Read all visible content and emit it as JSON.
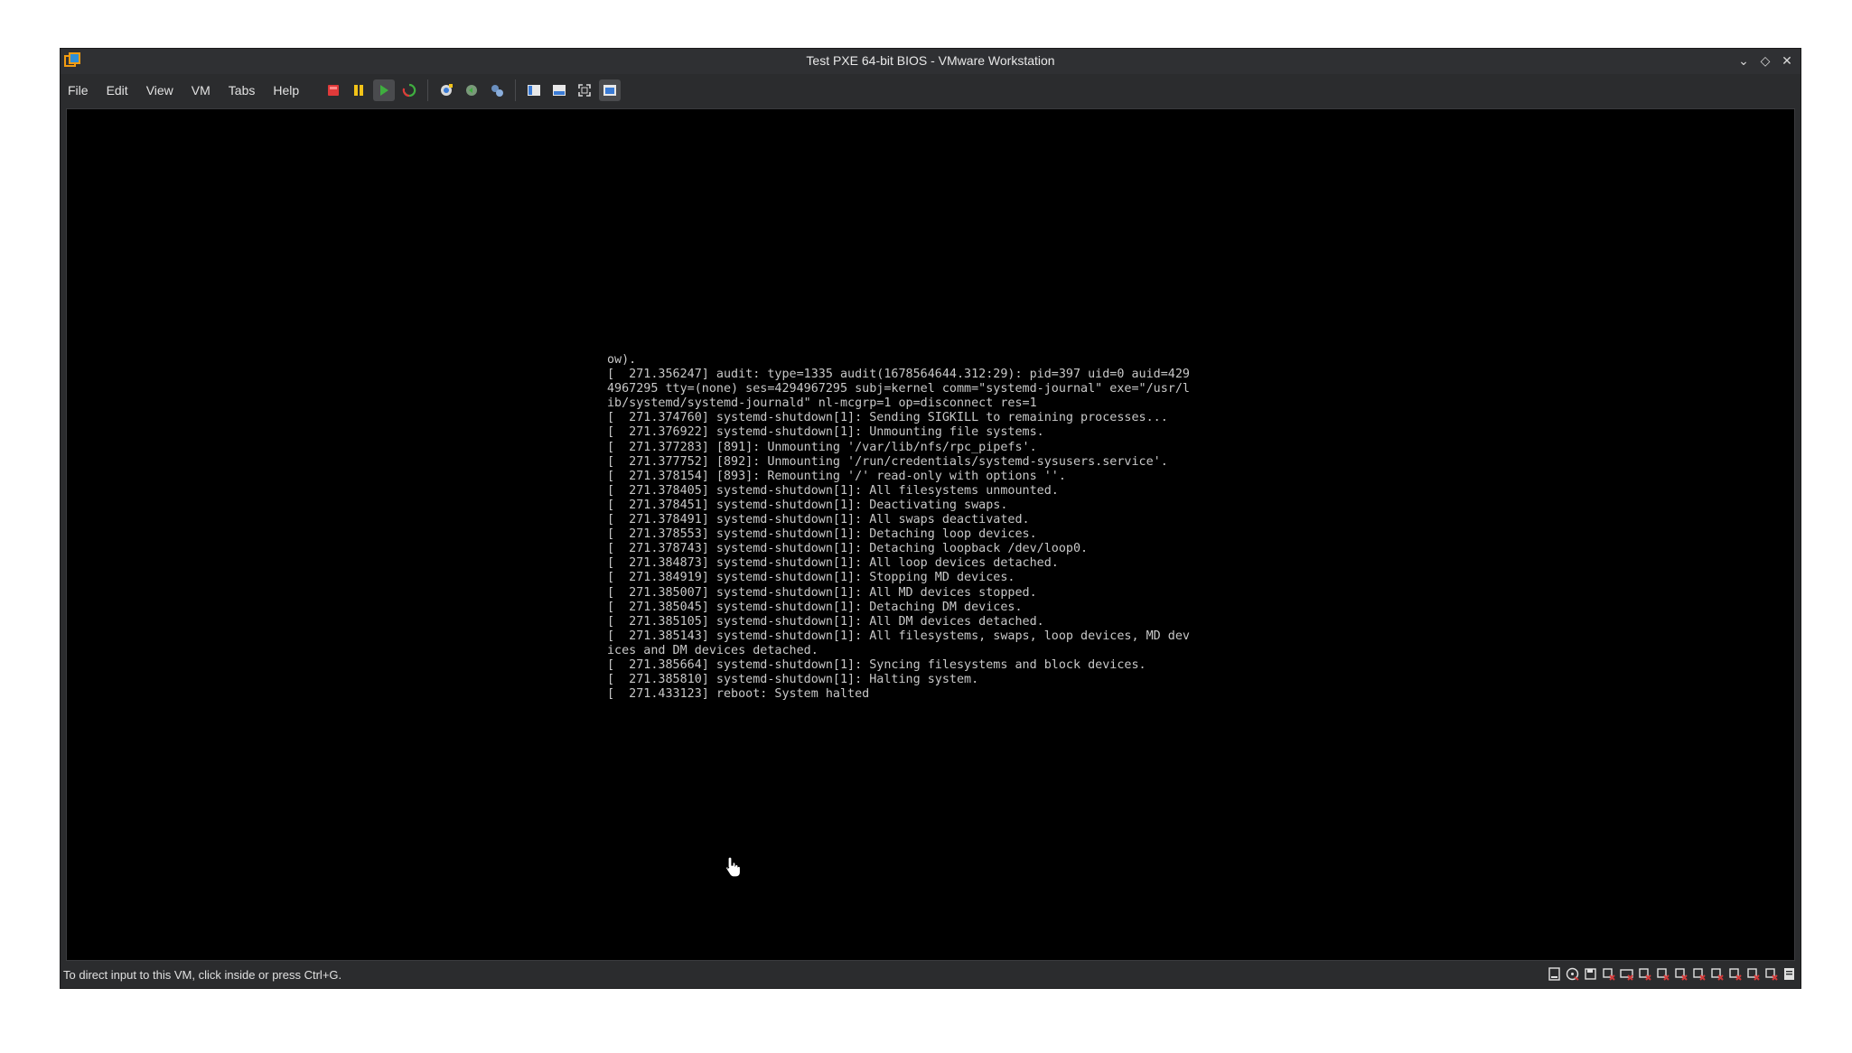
{
  "window": {
    "title": "Test PXE 64-bit BIOS - VMware Workstation"
  },
  "window_controls": [
    {
      "name": "minimize-icon",
      "glyph": "⌄"
    },
    {
      "name": "maximize-icon",
      "glyph": "◇"
    },
    {
      "name": "close-icon",
      "glyph": "✕"
    }
  ],
  "menu": {
    "file": "File",
    "edit": "Edit",
    "view": "View",
    "vm": "VM",
    "tabs": "Tabs",
    "help": "Help"
  },
  "toolbar_icons": [
    "power-off-icon",
    "suspend-icon",
    "power-on-icon",
    "restart-icon",
    "snapshot-icon",
    "revert-snapshot-icon",
    "snapshot-manager-icon",
    "library-icon",
    "thumbnail-bar-icon",
    "fullscreen-icon",
    "console-view-icon"
  ],
  "console": {
    "lines": [
      "ow).",
      "[  271.356247] audit: type=1335 audit(1678564644.312:29): pid=397 uid=0 auid=429",
      "4967295 tty=(none) ses=4294967295 subj=kernel comm=\"systemd-journal\" exe=\"/usr/l",
      "ib/systemd/systemd-journald\" nl-mcgrp=1 op=disconnect res=1",
      "[  271.374760] systemd-shutdown[1]: Sending SIGKILL to remaining processes...",
      "[  271.376922] systemd-shutdown[1]: Unmounting file systems.",
      "[  271.377283] [891]: Unmounting '/var/lib/nfs/rpc_pipefs'.",
      "[  271.377752] [892]: Unmounting '/run/credentials/systemd-sysusers.service'.",
      "[  271.378154] [893]: Remounting '/' read-only with options ''.",
      "[  271.378405] systemd-shutdown[1]: All filesystems unmounted.",
      "[  271.378451] systemd-shutdown[1]: Deactivating swaps.",
      "[  271.378491] systemd-shutdown[1]: All swaps deactivated.",
      "[  271.378553] systemd-shutdown[1]: Detaching loop devices.",
      "[  271.378743] systemd-shutdown[1]: Detaching loopback /dev/loop0.",
      "[  271.384873] systemd-shutdown[1]: All loop devices detached.",
      "[  271.384919] systemd-shutdown[1]: Stopping MD devices.",
      "[  271.385007] systemd-shutdown[1]: All MD devices stopped.",
      "[  271.385045] systemd-shutdown[1]: Detaching DM devices.",
      "[  271.385105] systemd-shutdown[1]: All DM devices detached.",
      "[  271.385143] systemd-shutdown[1]: All filesystems, swaps, loop devices, MD dev",
      "ices and DM devices detached.",
      "[  271.385664] systemd-shutdown[1]: Syncing filesystems and block devices.",
      "[  271.385810] systemd-shutdown[1]: Halting system.",
      "[  271.433123] reboot: System halted"
    ]
  },
  "statusbar": {
    "message": "To direct input to this VM, click inside or press Ctrl+G."
  },
  "device_icons": [
    "hard-disk-icon",
    "cd-dvd-icon",
    "floppy-icon",
    "network-adapter-icon",
    "usb-controller-icon",
    "sound-card-icon",
    "printer-icon",
    "display-icon",
    "serial-port-icon",
    "parallel-port-icon",
    "bluetooth-icon",
    "camera-icon",
    "shared-folder-icon",
    "message-log-icon"
  ],
  "colors": {
    "chrome_bg": "#2b2c2e",
    "console_fg": "#c8c8c8",
    "console_bg": "#000000",
    "power_off_red": "#e03a3a",
    "suspend_yellow": "#f2c318",
    "power_on_green": "#3fae3f",
    "device_red": "#d33a3a"
  }
}
